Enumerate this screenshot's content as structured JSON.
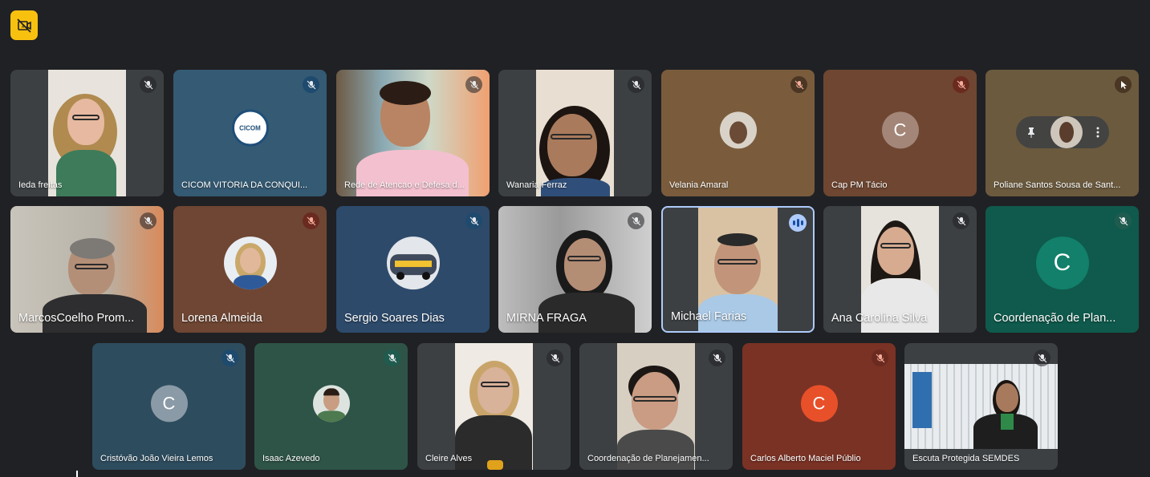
{
  "colors": {
    "background": "#202124",
    "badge": "#f9c10f",
    "speaking_border": "#aecbfa"
  },
  "badge_icon": "no-video-camera-icon",
  "participants": [
    {
      "name": "Ieda freitas",
      "mic": "muted"
    },
    {
      "name": "CICOM VITÓRIA DA CONQUI...",
      "mic": "muted",
      "logo_text": "CICOM"
    },
    {
      "name": "Rede de Atencao e Defesa d...",
      "mic": "muted"
    },
    {
      "name": "Wanaria Ferraz",
      "mic": "muted"
    },
    {
      "name": "Velania Amaral",
      "mic": "muted"
    },
    {
      "name": "Cap PM Tácio",
      "mic": "muted",
      "initial": "C"
    },
    {
      "name": "Poliane Santos Sousa de Sant...",
      "mic": "muted"
    },
    {
      "name": "MarcosCoelho Prom...",
      "mic": "muted"
    },
    {
      "name": "Lorena Almeida",
      "mic": "muted"
    },
    {
      "name": "Sergio Soares Dias",
      "mic": "muted"
    },
    {
      "name": "MIRNA FRAGA",
      "mic": "muted"
    },
    {
      "name": "Michael Farias",
      "mic": "speaking"
    },
    {
      "name": "Ana Carolina Silva",
      "mic": "muted"
    },
    {
      "name": "Coordenação de Plan...",
      "mic": "muted",
      "initial": "C"
    },
    {
      "name": "Cristóvão João Vieira Lemos",
      "mic": "muted",
      "initial": "C"
    },
    {
      "name": "Isaac Azevedo",
      "mic": "muted"
    },
    {
      "name": "Cleire Alves",
      "mic": "muted"
    },
    {
      "name": "Coordenação de Planejamen...",
      "mic": "muted"
    },
    {
      "name": "Carlos Alberto Maciel Públio",
      "mic": "muted",
      "initial": "C"
    },
    {
      "name": "Escuta Protegida SEMDES",
      "mic": "muted"
    }
  ]
}
